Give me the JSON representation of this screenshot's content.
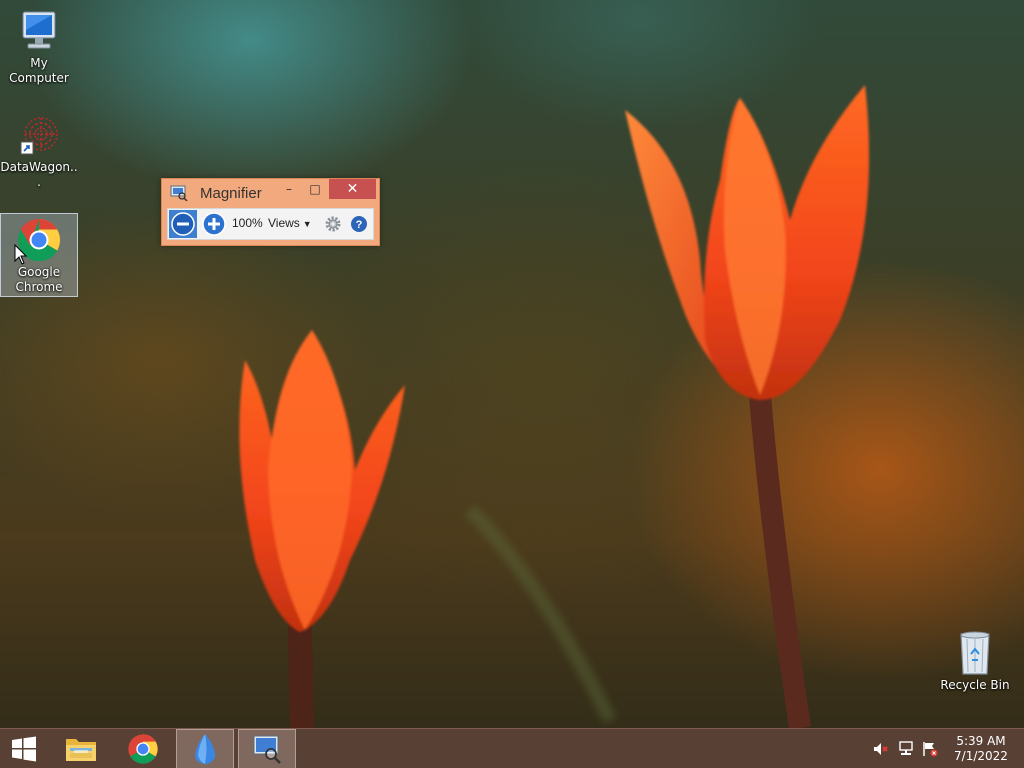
{
  "desktop": {
    "icons": [
      {
        "label": "My Computer",
        "icon": "computer-icon"
      },
      {
        "label": "DataWagon...",
        "icon": "datawagon-icon"
      },
      {
        "label": "Google Chrome",
        "icon": "chrome-icon",
        "selected": true
      },
      {
        "label": "Recycle Bin",
        "icon": "recycle-bin-icon"
      }
    ],
    "wallpaper": "orange tulips on dark green-orange background"
  },
  "magnifier": {
    "title": "Magnifier",
    "zoom_level": "100%",
    "views_label": "Views",
    "accent_color": "#f2a97d",
    "close_color": "#c75050"
  },
  "taskbar": {
    "background": "#5c4237",
    "pinned": [
      {
        "name": "start-button",
        "icon": "windows-logo-icon"
      },
      {
        "name": "file-explorer",
        "icon": "folder-icon"
      },
      {
        "name": "google-chrome",
        "icon": "chrome-icon"
      },
      {
        "name": "datawagon",
        "icon": "datawagon-icon",
        "active": true
      },
      {
        "name": "magnifier",
        "icon": "magnifier-icon",
        "active": true
      }
    ],
    "tray": {
      "icons": [
        "volume-muted-icon",
        "network-icon",
        "action-center-flag-icon"
      ],
      "time": "5:39 AM",
      "date": "7/1/2022"
    }
  }
}
